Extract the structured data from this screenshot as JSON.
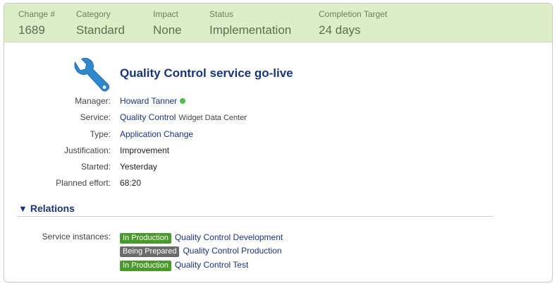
{
  "summary": {
    "change_label": "Change #",
    "change_value": "1689",
    "category_label": "Category",
    "category_value": "Standard",
    "impact_label": "Impact",
    "impact_value": "None",
    "status_label": "Status",
    "status_value": "Implementation",
    "target_label": "Completion Target",
    "target_value": "24 days"
  },
  "header": {
    "title": "Quality Control service go-live",
    "icon": "wrench-icon"
  },
  "fields": {
    "manager_label": "Manager:",
    "manager_value": "Howard Tanner",
    "service_label": "Service:",
    "service_value": "Quality Control",
    "service_sub": "Widget Data Center",
    "type_label": "Type:",
    "type_value": "Application Change",
    "justification_label": "Justification:",
    "justification_value": "Improvement",
    "started_label": "Started:",
    "started_value": "Yesterday",
    "effort_label": "Planned effort:",
    "effort_value": "68:20"
  },
  "relations": {
    "title": "Relations",
    "service_instances_label": "Service instances:",
    "items": [
      {
        "status": "In Production",
        "name": "Quality Control Development"
      },
      {
        "status": "Being Prepared",
        "name": "Quality Control Production"
      },
      {
        "status": "In Production",
        "name": "Quality Control Test"
      }
    ]
  },
  "colors": {
    "summary_bg": "#dcedc8",
    "link": "#19357a",
    "badge_green": "#4a9a2b",
    "badge_gray": "#6b6b6b",
    "online_dot": "#4cc04a"
  }
}
